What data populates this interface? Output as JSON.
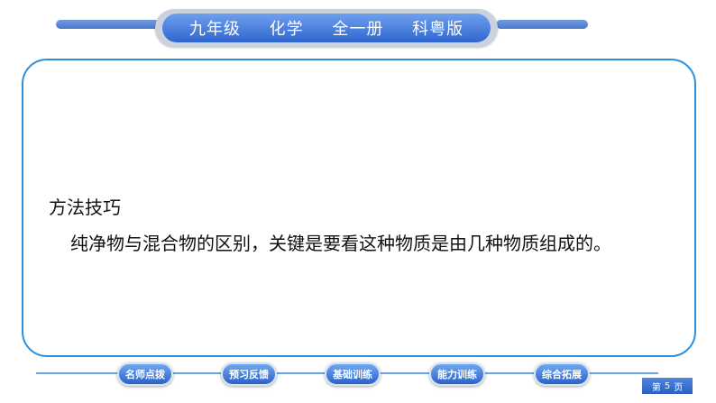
{
  "header": {
    "grade": "九年级",
    "subject": "化学",
    "volume": "全一册",
    "edition": "科粤版"
  },
  "content": {
    "heading": "方法技巧",
    "body": "纯净物与混合物的区别，关键是要看这种物质是由几种物质组成的。"
  },
  "nav": {
    "buttons": [
      {
        "label": "名师点拨"
      },
      {
        "label": "预习反馈"
      },
      {
        "label": "基础训练"
      },
      {
        "label": "能力训练"
      },
      {
        "label": "综合拓展"
      }
    ]
  },
  "page": {
    "prefix": "第",
    "number": "5",
    "suffix": "页"
  }
}
